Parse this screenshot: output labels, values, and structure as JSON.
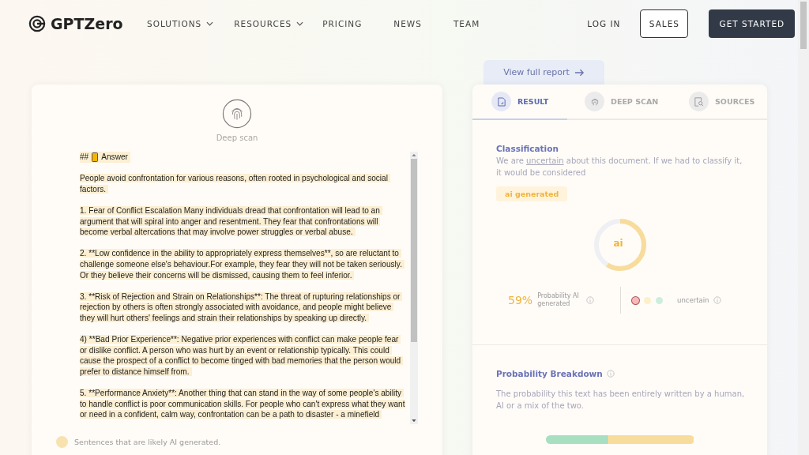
{
  "header": {
    "logo": "GPTZero",
    "nav": [
      {
        "label": "SOLUTIONS",
        "has_menu": true
      },
      {
        "label": "RESOURCES",
        "has_menu": true
      },
      {
        "label": "PRICING",
        "has_menu": false
      },
      {
        "label": "NEWS",
        "has_menu": false
      },
      {
        "label": "TEAM",
        "has_menu": false
      }
    ],
    "login": "LOG IN",
    "sales": "SALES",
    "cta": "GET STARTED"
  },
  "document": {
    "scan_label": "Deep scan",
    "heading": {
      "prefix": "##",
      "title": "Answer"
    },
    "paragraphs": [
      "People avoid confrontation for various reasons, often rooted in psychological and social factors.",
      "1. Fear of Conflict Escalation Many individuals dread that confrontation will lead to an argument that will spiral into anger and resentment. They fear that confrontations will become verbal altercations that may involve power struggles or verbal abuse.",
      "2. **Low confidence in the ability to appropriately express themselves**, so are reluctant to challenge someone else's behaviour.For example, they fear they will not be taken seriously. Or they believe their concerns will be dismissed, causing them to feel inferior.",
      "3. **Risk of Rejection and Strain on Relationships**: The threat of rupturing relationships or rejection by others is often strongly associated with avoidance, and people might believe they will hurt others' feelings and strain their relationships by speaking up directly.",
      "4) **Bad Prior Experience**: Negative prior experiences with conflict can make people fear or dislike conflict. A person who was hurt by an event or relationship typically. This could cause the prospect of a conflict to become tinged with bad memories that the person would prefer to distance himself from.",
      "5. **Performance Anxiety**: Another thing that can stand in the way of some people's ability to handle conflict is poor communication skills. For people who can't express what they want or need in a confident, calm way, confrontation can be a path to disaster - a minefield"
    ],
    "legend": {
      "label": "Sentences that are likely AI generated.",
      "color": "#f7e2b0"
    }
  },
  "report": {
    "view_full": "View full report",
    "tabs": [
      {
        "label": "RESULT",
        "selected": true
      },
      {
        "label": "DEEP SCAN",
        "selected": false
      },
      {
        "label": "SOURCES",
        "selected": false
      }
    ],
    "classification": {
      "title": "Classification",
      "text_before": "We are",
      "uncertain": "uncertain",
      "text_after": "about this document. If we had to classify it, it would be considered",
      "badge": "ai generated"
    },
    "gauge": {
      "label": "ai"
    },
    "probability": {
      "value": "59%",
      "label": "Probability AI generated"
    },
    "confidence": {
      "dots": [
        {
          "color": "#f6b9b9",
          "selected": true
        },
        {
          "color": "#fbf0c8",
          "selected": false
        },
        {
          "color": "#cdeedd",
          "selected": false
        }
      ],
      "label": "uncertain"
    },
    "breakdown": {
      "title": "Probability Breakdown",
      "text": "The probability this text has been entirely written by a human, AI or a mix of the two.",
      "segments": [
        {
          "level": 0.41,
          "color": "#a8dfc0"
        },
        {
          "level": 0.005,
          "color": "#a9c4e8"
        },
        {
          "level": 0.585,
          "color": "#f8dc9c"
        }
      ]
    }
  }
}
